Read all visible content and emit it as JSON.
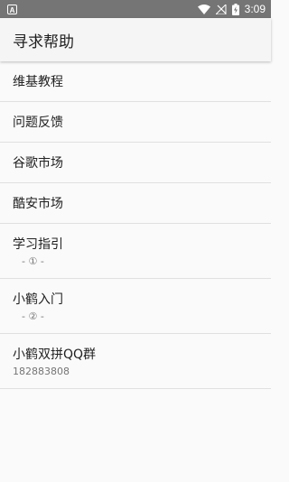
{
  "status_bar": {
    "notification_icon_label": "A",
    "time": "3:09",
    "icons": [
      "wifi-icon",
      "signal-off-icon",
      "battery-charging-icon"
    ],
    "color": "#757575"
  },
  "app_bar": {
    "title": "寻求帮助"
  },
  "list": {
    "items": [
      {
        "title": "维基教程"
      },
      {
        "title": "问题反馈"
      },
      {
        "title": "谷歌市场"
      },
      {
        "title": "酷安市场"
      },
      {
        "title": "学习指引",
        "subtitle": "- ① -"
      },
      {
        "title": "小鹤入门",
        "subtitle": "- ② -"
      },
      {
        "title": "小鹤双拼QQ群",
        "subtitle": "182883808"
      }
    ]
  }
}
